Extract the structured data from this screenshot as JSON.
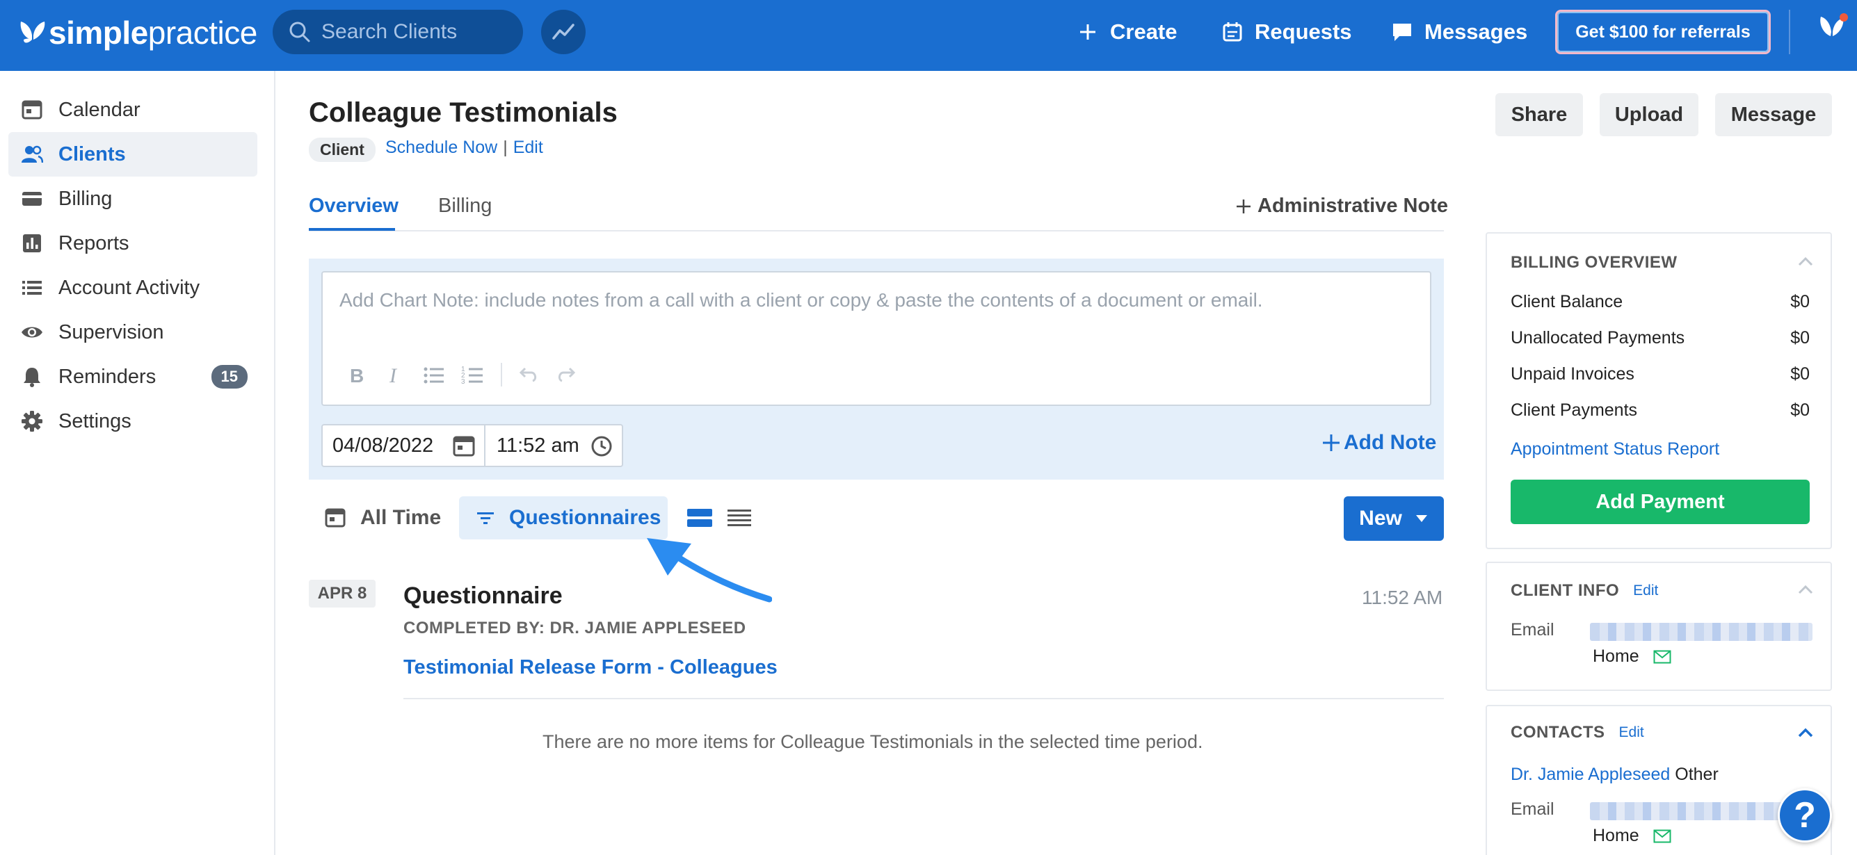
{
  "app": {
    "logo_bold": "simple",
    "logo_light": "practice",
    "search_placeholder": "Search Clients",
    "nav": {
      "create": "Create",
      "requests": "Requests",
      "messages": "Messages",
      "referral": "Get $100 for referrals"
    }
  },
  "sidebar": {
    "items": [
      {
        "label": "Calendar",
        "icon": "calendar-icon"
      },
      {
        "label": "Clients",
        "icon": "clients-icon",
        "active": true
      },
      {
        "label": "Billing",
        "icon": "billing-icon"
      },
      {
        "label": "Reports",
        "icon": "reports-icon"
      },
      {
        "label": "Account Activity",
        "icon": "list-icon"
      },
      {
        "label": "Supervision",
        "icon": "eye-icon"
      },
      {
        "label": "Reminders",
        "icon": "bell-icon",
        "badge": "15"
      },
      {
        "label": "Settings",
        "icon": "gear-icon"
      }
    ]
  },
  "client": {
    "name": "Colleague Testimonials",
    "type_chip": "Client",
    "schedule_now": "Schedule Now",
    "separator": "|",
    "edit": "Edit"
  },
  "header_actions": {
    "share": "Share",
    "upload": "Upload",
    "message": "Message"
  },
  "tabs": [
    {
      "label": "Overview",
      "active": true
    },
    {
      "label": "Billing"
    }
  ],
  "admin_note": "Administrative Note",
  "chart_note": {
    "placeholder": "Add Chart Note: include notes from a call with a client or copy & paste the contents of a document or email.",
    "date": "04/08/2022",
    "time": "11:52 am",
    "add_note": "Add Note"
  },
  "filters": {
    "time": "All Time",
    "type": "Questionnaires",
    "new": "New"
  },
  "timeline": {
    "date_chip": "APR 8",
    "title": "Questionnaire",
    "completed_by": "COMPLETED BY: DR. JAMIE APPLESEED",
    "link": "Testimonial Release Form - Colleagues",
    "time": "11:52 AM",
    "empty_message": "There are no more items for Colleague Testimonials in the selected time period."
  },
  "billing_overview": {
    "heading": "BILLING OVERVIEW",
    "rows": [
      {
        "label": "Client Balance",
        "value": "$0"
      },
      {
        "label": "Unallocated Payments",
        "value": "$0"
      },
      {
        "label": "Unpaid Invoices",
        "value": "$0"
      },
      {
        "label": "Client Payments",
        "value": "$0"
      }
    ],
    "report_link": "Appointment Status Report",
    "add_payment": "Add Payment"
  },
  "client_info": {
    "heading": "CLIENT INFO",
    "edit": "Edit",
    "email_label": "Email",
    "email_type": "Home"
  },
  "contacts": {
    "heading": "CONTACTS",
    "edit": "Edit",
    "contact_name": "Dr. Jamie Appleseed",
    "contact_role": "Other",
    "email_label": "Email",
    "email_type": "Home"
  },
  "help": "?",
  "colors": {
    "brand": "#1a6ed0",
    "success": "#18b86a",
    "note_bg": "#e4effa"
  }
}
